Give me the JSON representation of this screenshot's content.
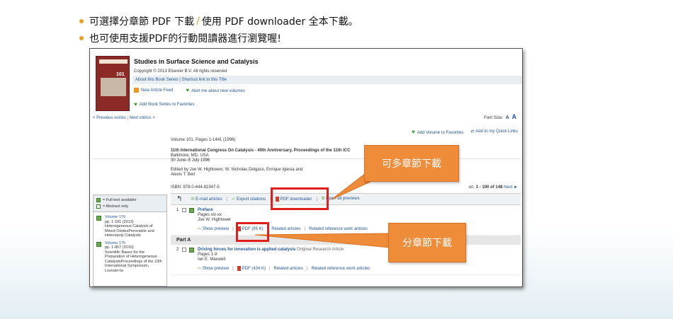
{
  "bullets": [
    {
      "part1": "可選擇分章節 PDF 下載",
      "slash": "/",
      "part2": "使用 PDF downloader 全本下載。"
    },
    {
      "part1": "也可使用支援PDF的行動閱讀器進行瀏覽喔!"
    }
  ],
  "book": {
    "cover_volume": "101",
    "title": "Studies in Surface Science and Catalysis",
    "copyright": "Copyright © 2013 Elsevier B.V. All rights reserved",
    "about_link": "About this Book Series",
    "shortcut_link": "Shortcut link to this Title",
    "new_article_feed": "New Article Feed",
    "alert_new_volumes": "Alert me about new volumes",
    "add_to_favorites": "Add Book Series to Favorites"
  },
  "nav": {
    "prev": "< Previous vol/iss",
    "separator": "|",
    "next": "Next vol/iss >",
    "font_size_label": "Font Size:",
    "font_small": "A",
    "font_large": "A"
  },
  "volume": {
    "add_volume_fav": "Add Volume to Favorites",
    "add_quicklinks": "Add to my Quick Links",
    "pages": "Volume 101, Pages 1-1441 (1996)",
    "congress": "11th International Congress On Catalysis - 40th Anniversary, Proceedings of the 11th ICC",
    "location": "Baltimore, MD, USA",
    "dates": "30 June–5 July 1996",
    "editors": "Edited by Joe W. Hightower, W. Nicholas Delgass, Enrique Iglesia and",
    "editor2": "Alexis T. Bell",
    "isbn": "ISBN: 978-0-444-81947-5",
    "pager_prefix": "art.",
    "pager_range": "1 - 100 of 148",
    "pager_next": "Next ►"
  },
  "sidebar": {
    "legend_full": "= Full-text available",
    "legend_abstract": "= Abstract only",
    "volumes": [
      {
        "link": "Volume 176",
        "pages": "pp. 1-181 (2013)",
        "desc": "Heterogeneous Catalysis of Mixed OxidesPerovskite and Heteropoly Catalysts"
      },
      {
        "link": "Volume 175",
        "pages": "pp. 1-867 (2010)",
        "desc": "Scientific Bases for the Preparation of Heterogeneous CatalystsProceedings of the 10th International Symposium, Louvain-la-"
      }
    ]
  },
  "toolbar": {
    "email": "E-mail articles",
    "export": "Export citations",
    "pdf_downloader": "PDF downloader",
    "open_previews": "Open all previews"
  },
  "articles": [
    {
      "num": "1",
      "title": "Preface",
      "pages": "Pages xix-xx",
      "author": "Joe W. Hightower",
      "show_preview": "Show preview",
      "pdf": "PDF (85 K)",
      "related": "Related articles",
      "related_ref": "Related reference work articles"
    }
  ],
  "part_a": "Part A",
  "articles2": [
    {
      "num": "2",
      "title": "Driving forces for innovation is applied catalysis",
      "type": "Original Research Article",
      "pages": "Pages 1-9",
      "author": "Ian E. Maxwell",
      "show_preview": "Show preview",
      "pdf": "PDF (434 K)",
      "related": "Related articles",
      "related_ref": "Related reference work articles"
    }
  ],
  "callouts": {
    "multi_chapter": "可多章節下載",
    "chapter": "分章節下載"
  },
  "colors": {
    "accent": "#ef8c3a",
    "highlight": "#e21d1d",
    "link": "#24569d"
  }
}
